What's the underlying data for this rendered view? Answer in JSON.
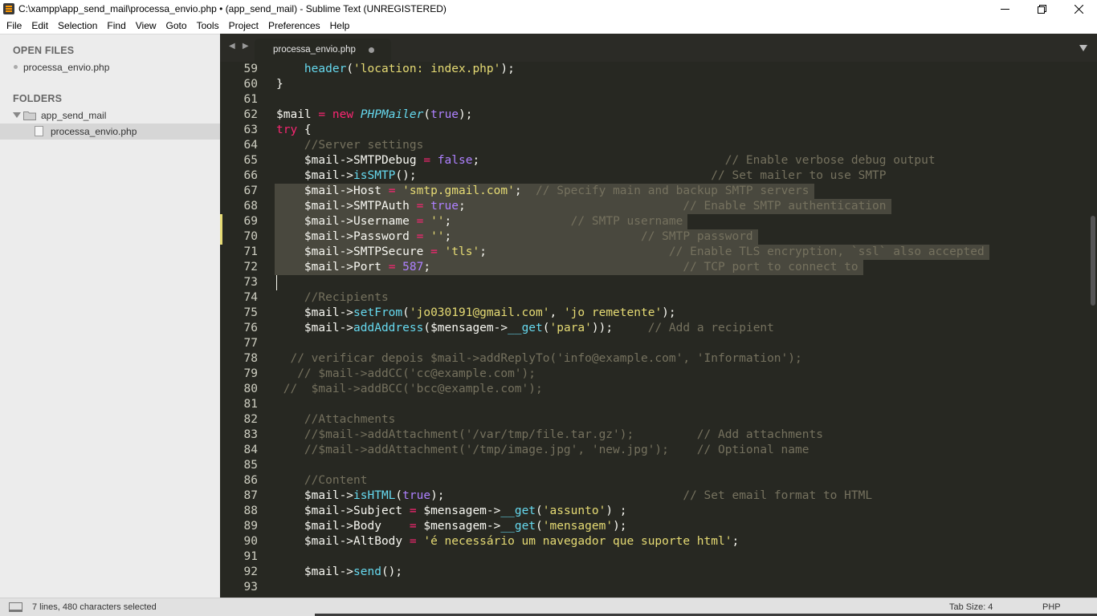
{
  "window": {
    "title": "C:\\xampp\\app_send_mail\\processa_envio.php • (app_send_mail) - Sublime Text (UNREGISTERED)"
  },
  "menu": [
    "File",
    "Edit",
    "Selection",
    "Find",
    "View",
    "Goto",
    "Tools",
    "Project",
    "Preferences",
    "Help"
  ],
  "sidebar": {
    "open_files_heading": "OPEN FILES",
    "open_files": [
      "processa_envio.php"
    ],
    "folders_heading": "FOLDERS",
    "folder_name": "app_send_mail",
    "folder_files": [
      "processa_envio.php"
    ]
  },
  "tab": {
    "label": "processa_envio.php",
    "nav_arrows": "◀ ▶"
  },
  "editor": {
    "theme_colors": {
      "background": "#272822",
      "default": "#f8f8f2",
      "keyword": "#f92672",
      "string": "#e6db74",
      "function": "#66d9ef",
      "constant": "#ae81ff",
      "comment": "#75715e"
    },
    "selection_lines": [
      67,
      68,
      69,
      70,
      71,
      72
    ],
    "modified_lines": [
      69,
      70
    ],
    "caret_line": 73,
    "lines": [
      {
        "n": "59",
        "tokens": [
          [
            "    ",
            ""
          ],
          [
            "header",
            "f"
          ],
          [
            "(",
            ""
          ],
          [
            "'location: index.php'",
            "s"
          ],
          [
            ");",
            ""
          ]
        ]
      },
      {
        "n": "60",
        "tokens": [
          [
            "}",
            ""
          ]
        ]
      },
      {
        "n": "61",
        "tokens": []
      },
      {
        "n": "62",
        "tokens": [
          [
            "$mail ",
            ""
          ],
          [
            "=",
            "k"
          ],
          [
            " ",
            ""
          ],
          [
            "new",
            "k"
          ],
          [
            " ",
            ""
          ],
          [
            "PHPMailer",
            "fi"
          ],
          [
            "(",
            ""
          ],
          [
            "true",
            "c"
          ],
          [
            ");",
            ""
          ]
        ]
      },
      {
        "n": "63",
        "tokens": [
          [
            "try",
            "k"
          ],
          [
            " {",
            ""
          ]
        ]
      },
      {
        "n": "64",
        "tokens": [
          [
            "    ",
            ""
          ],
          [
            "//Server settings",
            "m"
          ]
        ]
      },
      {
        "n": "65",
        "tokens": [
          [
            "    $mail->SMTPDebug ",
            ""
          ],
          [
            "=",
            "k"
          ],
          [
            " ",
            ""
          ],
          [
            "false",
            "c"
          ],
          [
            ";",
            ""
          ],
          [
            "                                   // Enable verbose debug output",
            "m"
          ]
        ]
      },
      {
        "n": "66",
        "tokens": [
          [
            "    $mail->",
            ""
          ],
          [
            "isSMTP",
            "f"
          ],
          [
            "();",
            ""
          ],
          [
            "                                          // Set mailer to use SMTP",
            "m"
          ]
        ]
      },
      {
        "n": "67",
        "tokens": [
          [
            "    $mail->Host ",
            ""
          ],
          [
            "=",
            "k"
          ],
          [
            " ",
            ""
          ],
          [
            "'smtp.gmail.com'",
            "s"
          ],
          [
            ";",
            ""
          ],
          [
            "  // Specify main and backup SMTP servers",
            "m"
          ]
        ]
      },
      {
        "n": "68",
        "tokens": [
          [
            "    $mail->SMTPAuth ",
            ""
          ],
          [
            "=",
            "k"
          ],
          [
            " ",
            ""
          ],
          [
            "true",
            "c"
          ],
          [
            ";",
            ""
          ],
          [
            "                               // Enable SMTP authentication",
            "m"
          ]
        ]
      },
      {
        "n": "69",
        "tokens": [
          [
            "    $mail->Username ",
            ""
          ],
          [
            "=",
            "k"
          ],
          [
            " ",
            ""
          ],
          [
            "''",
            "s"
          ],
          [
            ";",
            ""
          ],
          [
            "                 // SMTP username",
            "m"
          ]
        ]
      },
      {
        "n": "70",
        "tokens": [
          [
            "    $mail->Password ",
            ""
          ],
          [
            "=",
            "k"
          ],
          [
            " ",
            ""
          ],
          [
            "''",
            "s"
          ],
          [
            ";",
            ""
          ],
          [
            "                           // SMTP password",
            "m"
          ]
        ]
      },
      {
        "n": "71",
        "tokens": [
          [
            "    $mail->SMTPSecure ",
            ""
          ],
          [
            "=",
            "k"
          ],
          [
            " ",
            ""
          ],
          [
            "'tls'",
            "s"
          ],
          [
            ";",
            ""
          ],
          [
            "                          // Enable TLS encryption, `ssl` also accepted",
            "m"
          ]
        ]
      },
      {
        "n": "72",
        "tokens": [
          [
            "    $mail->Port ",
            ""
          ],
          [
            "=",
            "k"
          ],
          [
            " ",
            ""
          ],
          [
            "587",
            "c"
          ],
          [
            ";",
            ""
          ],
          [
            "                                    // TCP port to connect to",
            "m"
          ]
        ]
      },
      {
        "n": "73",
        "tokens": []
      },
      {
        "n": "74",
        "tokens": [
          [
            "    ",
            ""
          ],
          [
            "//Recipients",
            "m"
          ]
        ]
      },
      {
        "n": "75",
        "tokens": [
          [
            "    $mail->",
            ""
          ],
          [
            "setFrom",
            "f"
          ],
          [
            "(",
            ""
          ],
          [
            "'jo030191@gmail.com'",
            "s"
          ],
          [
            ", ",
            ""
          ],
          [
            "'jo remetente'",
            "s"
          ],
          [
            ");",
            ""
          ]
        ]
      },
      {
        "n": "76",
        "tokens": [
          [
            "    $mail->",
            ""
          ],
          [
            "addAddress",
            "f"
          ],
          [
            "($mensagem->",
            ""
          ],
          [
            "__get",
            "f"
          ],
          [
            "(",
            ""
          ],
          [
            "'para'",
            "s"
          ],
          [
            "));",
            ""
          ],
          [
            "     // Add a recipient",
            "m"
          ]
        ]
      },
      {
        "n": "77",
        "tokens": []
      },
      {
        "n": "78",
        "tokens": [
          [
            "  // verificar depois $mail->addReplyTo('info@example.com', 'Information');",
            "m"
          ]
        ]
      },
      {
        "n": "79",
        "tokens": [
          [
            "   // $mail->addCC('cc@example.com');",
            "m"
          ]
        ]
      },
      {
        "n": "80",
        "tokens": [
          [
            " //  $mail->addBCC('bcc@example.com');",
            "m"
          ]
        ]
      },
      {
        "n": "81",
        "tokens": []
      },
      {
        "n": "82",
        "tokens": [
          [
            "    ",
            ""
          ],
          [
            "//Attachments",
            "m"
          ]
        ]
      },
      {
        "n": "83",
        "tokens": [
          [
            "    ",
            ""
          ],
          [
            "//$mail->addAttachment('/var/tmp/file.tar.gz');         // Add attachments",
            "m"
          ]
        ]
      },
      {
        "n": "84",
        "tokens": [
          [
            "    ",
            ""
          ],
          [
            "//$mail->addAttachment('/tmp/image.jpg', 'new.jpg');    // Optional name",
            "m"
          ]
        ]
      },
      {
        "n": "85",
        "tokens": []
      },
      {
        "n": "86",
        "tokens": [
          [
            "    ",
            ""
          ],
          [
            "//Content",
            "m"
          ]
        ]
      },
      {
        "n": "87",
        "tokens": [
          [
            "    $mail->",
            ""
          ],
          [
            "isHTML",
            "f"
          ],
          [
            "(",
            ""
          ],
          [
            "true",
            "c"
          ],
          [
            ");",
            ""
          ],
          [
            "                                  // Set email format to HTML",
            "m"
          ]
        ]
      },
      {
        "n": "88",
        "tokens": [
          [
            "    $mail->Subject ",
            ""
          ],
          [
            "=",
            "k"
          ],
          [
            " $mensagem->",
            ""
          ],
          [
            "__get",
            "f"
          ],
          [
            "(",
            ""
          ],
          [
            "'assunto'",
            "s"
          ],
          [
            ") ;",
            ""
          ]
        ]
      },
      {
        "n": "89",
        "tokens": [
          [
            "    $mail->Body    ",
            ""
          ],
          [
            "=",
            "k"
          ],
          [
            " $mensagem->",
            ""
          ],
          [
            "__get",
            "f"
          ],
          [
            "(",
            ""
          ],
          [
            "'mensagem'",
            "s"
          ],
          [
            ");",
            ""
          ]
        ]
      },
      {
        "n": "90",
        "tokens": [
          [
            "    $mail->AltBody ",
            ""
          ],
          [
            "=",
            "k"
          ],
          [
            " ",
            ""
          ],
          [
            "'é necessário um navegador que suporte html'",
            "s"
          ],
          [
            ";",
            ""
          ]
        ]
      },
      {
        "n": "91",
        "tokens": []
      },
      {
        "n": "92",
        "tokens": [
          [
            "    $mail->",
            ""
          ],
          [
            "send",
            "f"
          ],
          [
            "();",
            ""
          ]
        ]
      },
      {
        "n": "93",
        "tokens": []
      }
    ]
  },
  "status": {
    "selection": "7 lines, 480 characters selected",
    "tab_size": "Tab Size: 4",
    "syntax": "PHP"
  }
}
